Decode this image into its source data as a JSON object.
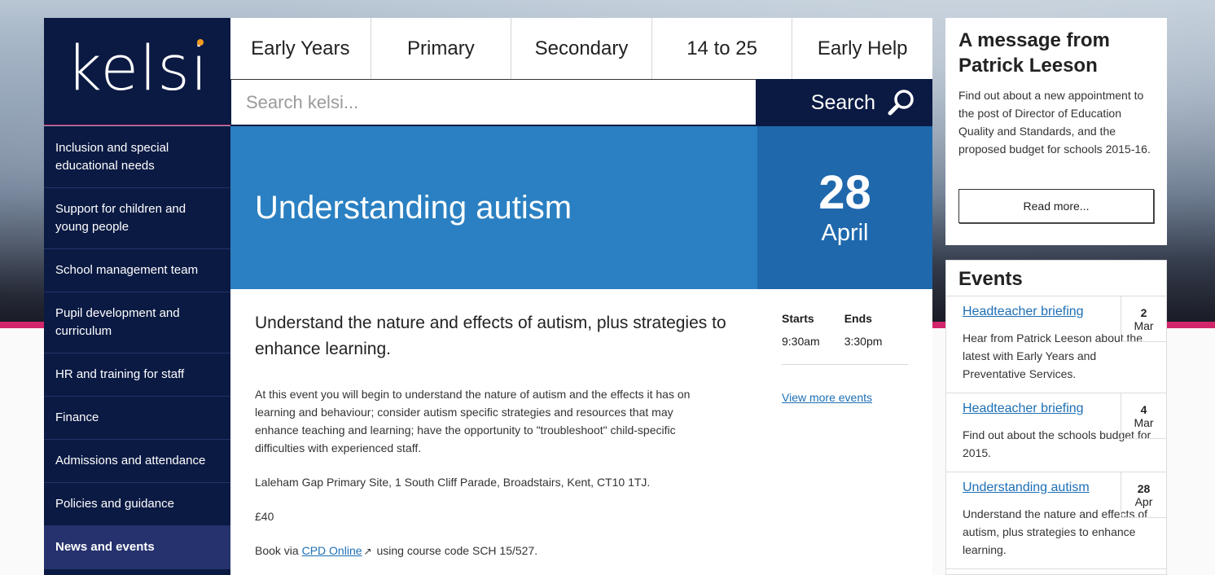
{
  "brand": {
    "logo_text": "kelsi",
    "accent": "#f39b1e",
    "navy": "#0b1a43",
    "pink": "#d2266b",
    "blue": "#2a80c2"
  },
  "topnav": [
    "Early Years",
    "Primary",
    "Secondary",
    "14 to 25",
    "Early Help"
  ],
  "search": {
    "placeholder": "Search kelsi...",
    "button_label": "Search",
    "icon": "magnifier-icon"
  },
  "sidebar": [
    {
      "label": "Inclusion and special educational needs"
    },
    {
      "label": "Support for children and young people"
    },
    {
      "label": "School management team"
    },
    {
      "label": "Pupil development and curriculum"
    },
    {
      "label": "HR and training for staff"
    },
    {
      "label": "Finance"
    },
    {
      "label": "Admissions and attendance"
    },
    {
      "label": "Policies and guidance"
    },
    {
      "label": "News and events",
      "active": true
    }
  ],
  "hero": {
    "title": "Understanding autism",
    "day": "28",
    "month": "April"
  },
  "content": {
    "lead": "Understand the nature and effects of autism, plus strategies to enhance learning.",
    "description": "At this event you will begin to understand the nature of autism and the effects it has on learning and behaviour; consider autism specific strategies and resources that may enhance teaching and learning; have the opportunity to \"troubleshoot\" child-specific difficulties with experienced staff.",
    "location": "Laleham Gap Primary Site, 1 South Cliff Parade, Broadstairs, Kent, CT10 1TJ.",
    "price": "£40",
    "booking_prefix": "Book via",
    "booking_link": "CPD Online",
    "booking_suffix": "using course code SCH 15/527."
  },
  "times": {
    "starts_label": "Starts",
    "ends_label": "Ends",
    "starts": "9:30am",
    "ends": "3:30pm",
    "view_more": "View more events"
  },
  "message": {
    "title": "A message from Patrick Leeson",
    "body": "Find out about a new appointment to the post of Director of Education Quality and Standards, and the proposed budget for schools 2015-16.",
    "button": "Read more..."
  },
  "events": {
    "title": "Events",
    "items": [
      {
        "title": "Headteacher briefing",
        "desc": "Hear from Patrick Leeson about the latest with Early Years and Preventative Services.",
        "day": "2",
        "month": "Mar"
      },
      {
        "title": "Headteacher briefing",
        "desc": "Find out about the schools budget for 2015.",
        "day": "4",
        "month": "Mar"
      },
      {
        "title": "Understanding autism",
        "desc": "Understand the nature and effects of autism, plus strategies to enhance learning.",
        "day": "28",
        "month": "Apr"
      }
    ]
  }
}
